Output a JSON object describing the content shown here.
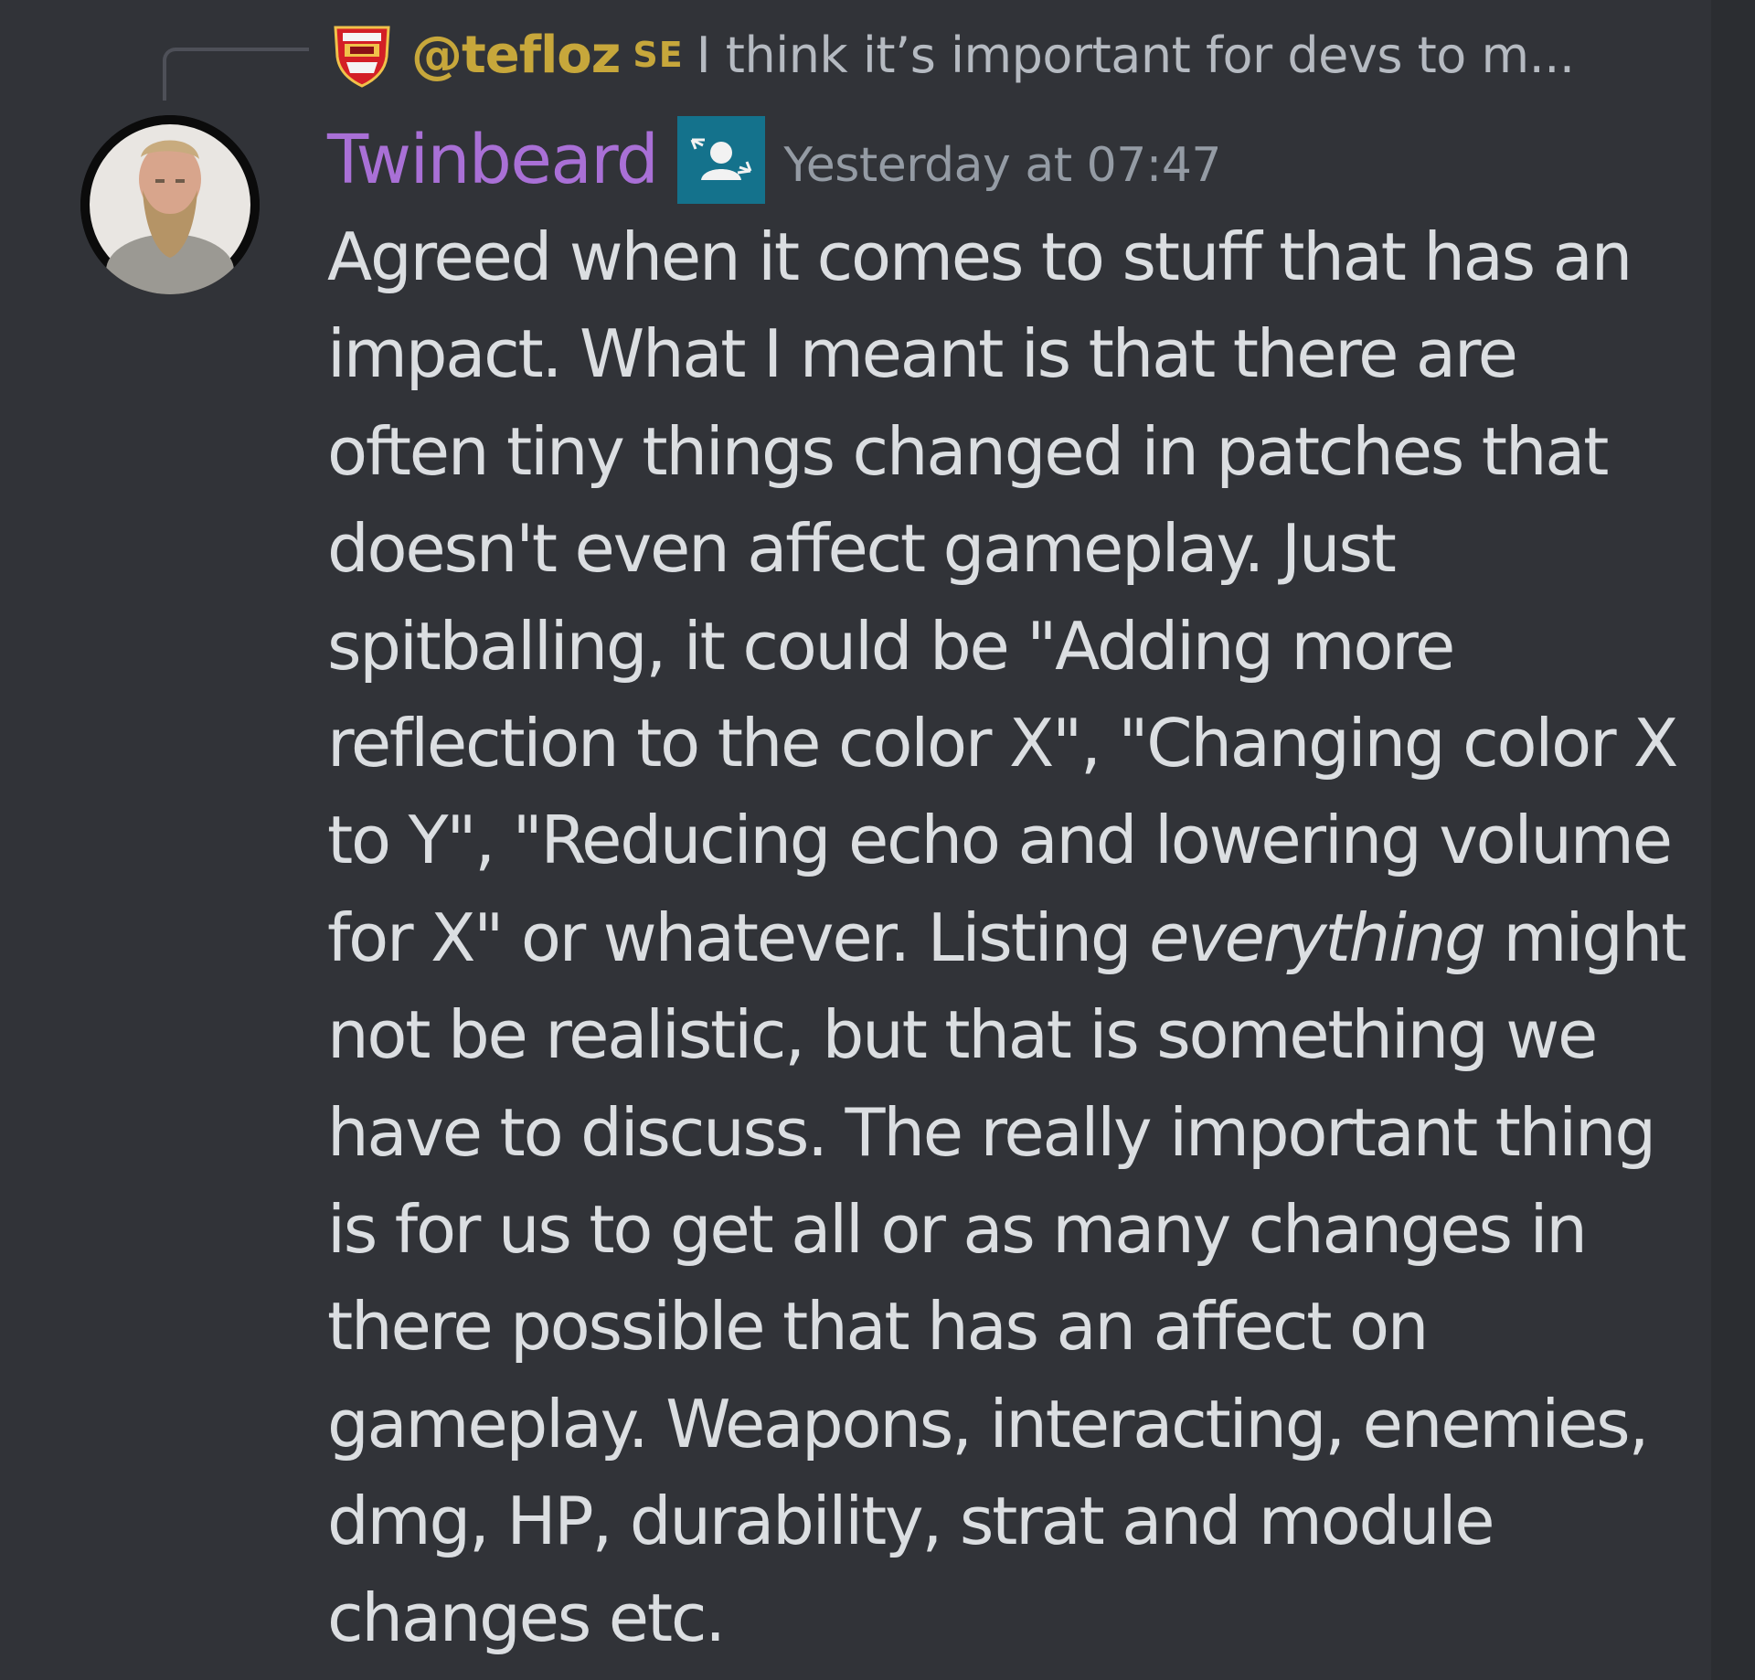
{
  "reply": {
    "username": "@tefloz",
    "tag": "SE",
    "preview": "I think it’s important for devs to m..."
  },
  "message": {
    "author": "Twinbeard",
    "timestamp": "Yesterday at 07:47",
    "lines": [
      [
        "Agreed when it comes to stuff that has an"
      ],
      [
        "impact. What I meant is that there are"
      ],
      [
        "often tiny things changed in patches that"
      ],
      [
        "doesn't even affect gameplay. Just"
      ],
      [
        "spitballing, it could be \"Adding more"
      ],
      [
        "reflection to the color X\", \"Changing color X"
      ],
      [
        "to Y\", \"Reducing echo and lowering volume"
      ],
      [
        "for X\" or whatever. Listing ",
        "everything",
        " might"
      ],
      [
        "not be realistic, but that is something we"
      ],
      [
        "have to discuss. The really important thing"
      ],
      [
        "is for us to get all or as many changes in"
      ],
      [
        "there possible that has an affect on"
      ],
      [
        "gameplay. Weapons, interacting, enemies,"
      ],
      [
        "dmg, HP, durability, strat and module"
      ],
      [
        "changes etc."
      ]
    ]
  },
  "icons": {
    "reply_avatar": "club-crest-avatar",
    "author_avatar": "user-photo-avatar",
    "role": "person-with-arrows-role-icon"
  },
  "colors": {
    "background": "#313338",
    "reply_name": "#c7a73b",
    "author_name": "#a970d6",
    "role_badge": "#14728c",
    "text": "#dbdee1",
    "timestamp": "#949ba4"
  }
}
